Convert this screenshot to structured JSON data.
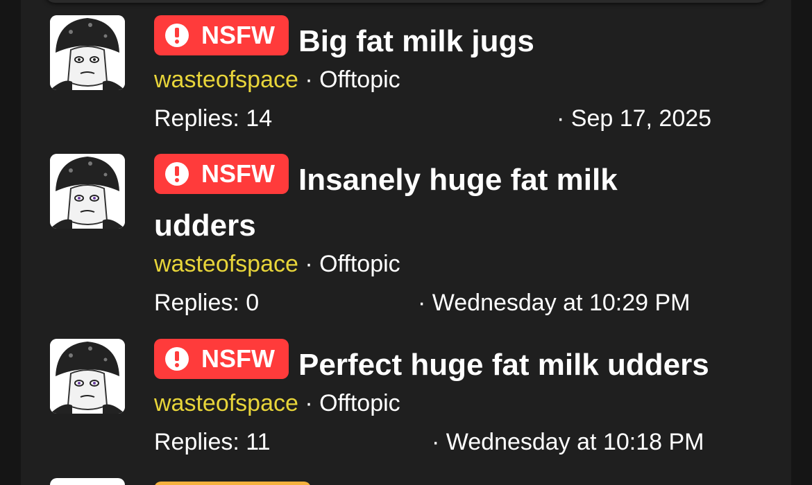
{
  "colors": {
    "badge_nsfw": "#ff3b3b",
    "author": "#e8d53a",
    "background": "#1f1f1f",
    "peek_badge": "#f5b13d"
  },
  "threads": [
    {
      "badge": "NSFW",
      "title": "Big fat milk jugs",
      "author": "wasteofspace",
      "separator": "·",
      "forum": "Offtopic",
      "replies": "Replies: 14",
      "date": "· Sep 17, 2025",
      "avatar_icon": "mushroom-avatar-icon"
    },
    {
      "badge": "NSFW",
      "title": "Insanely huge fat milk udders",
      "author": "wasteofspace",
      "separator": "·",
      "forum": "Offtopic",
      "replies": "Replies: 0",
      "date": "· Wednesday at 10:29 PM",
      "avatar_icon": "mushroom-avatar-icon"
    },
    {
      "badge": "NSFW",
      "title": "Perfect huge fat milk udders",
      "author": "wasteofspace",
      "separator": "·",
      "forum": "Offtopic",
      "replies": "Replies: 11",
      "date": "· Wednesday at 10:18 PM",
      "avatar_icon": "mushroom-avatar-icon"
    }
  ]
}
